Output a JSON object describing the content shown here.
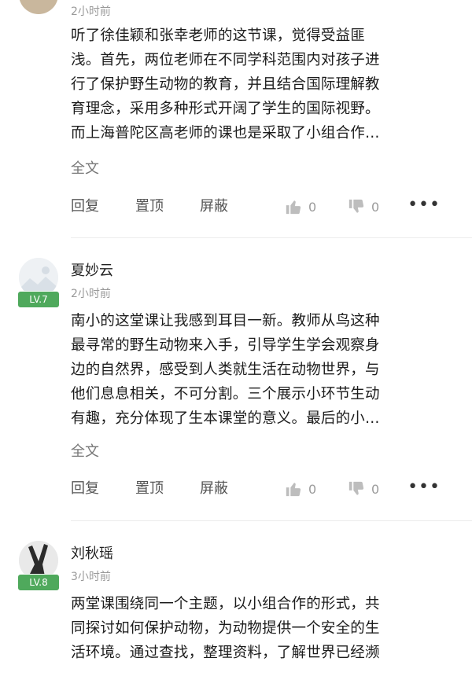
{
  "comments": [
    {
      "time": "2小时前",
      "lines": [
        "听了徐佳颖和张幸老师的这节课，觉得受益匪",
        "浅。首先，两位老师在不同学科范围内对孩子进",
        "行了保护野生动物的教育，并且结合国际理解教",
        "育理念，采用多种形式开阔了学生的国际视野。",
        "而上海普陀区高老师的课也是采取了小组合作…"
      ],
      "full_text_label": "全文",
      "reply_label": "回复",
      "pin_label": "置顶",
      "block_label": "屏蔽",
      "likes": "0",
      "dislikes": "0"
    },
    {
      "name": "夏妙云",
      "level": "LV.7",
      "time": "2小时前",
      "lines": [
        "南小的这堂课让我感到耳目一新。教师从鸟这种",
        "最寻常的野生动物来入手，引导学生学会观察身",
        "边的自然界，感受到人类就生活在动物世界，与",
        "他们息息相关，不可分割。三个展示小环节生动",
        "有趣，充分体现了生本课堂的意义。最后的小…"
      ],
      "full_text_label": "全文",
      "reply_label": "回复",
      "pin_label": "置顶",
      "block_label": "屏蔽",
      "likes": "0",
      "dislikes": "0"
    },
    {
      "name": "刘秋瑶",
      "level": "LV.8",
      "time": "3小时前",
      "lines": [
        "两堂课围绕同一个主题，以小组合作的形式，共",
        "同探讨如何保护动物，为动物提供一个安全的生",
        "活环境。通过查找，整理资料，了解世界已经濒"
      ]
    }
  ],
  "icons": [
    "thumbs-up-icon",
    "thumbs-down-icon",
    "more-icon"
  ],
  "colors": {
    "level_badge": "#4fa95c",
    "muted": "#9a9a9a"
  }
}
